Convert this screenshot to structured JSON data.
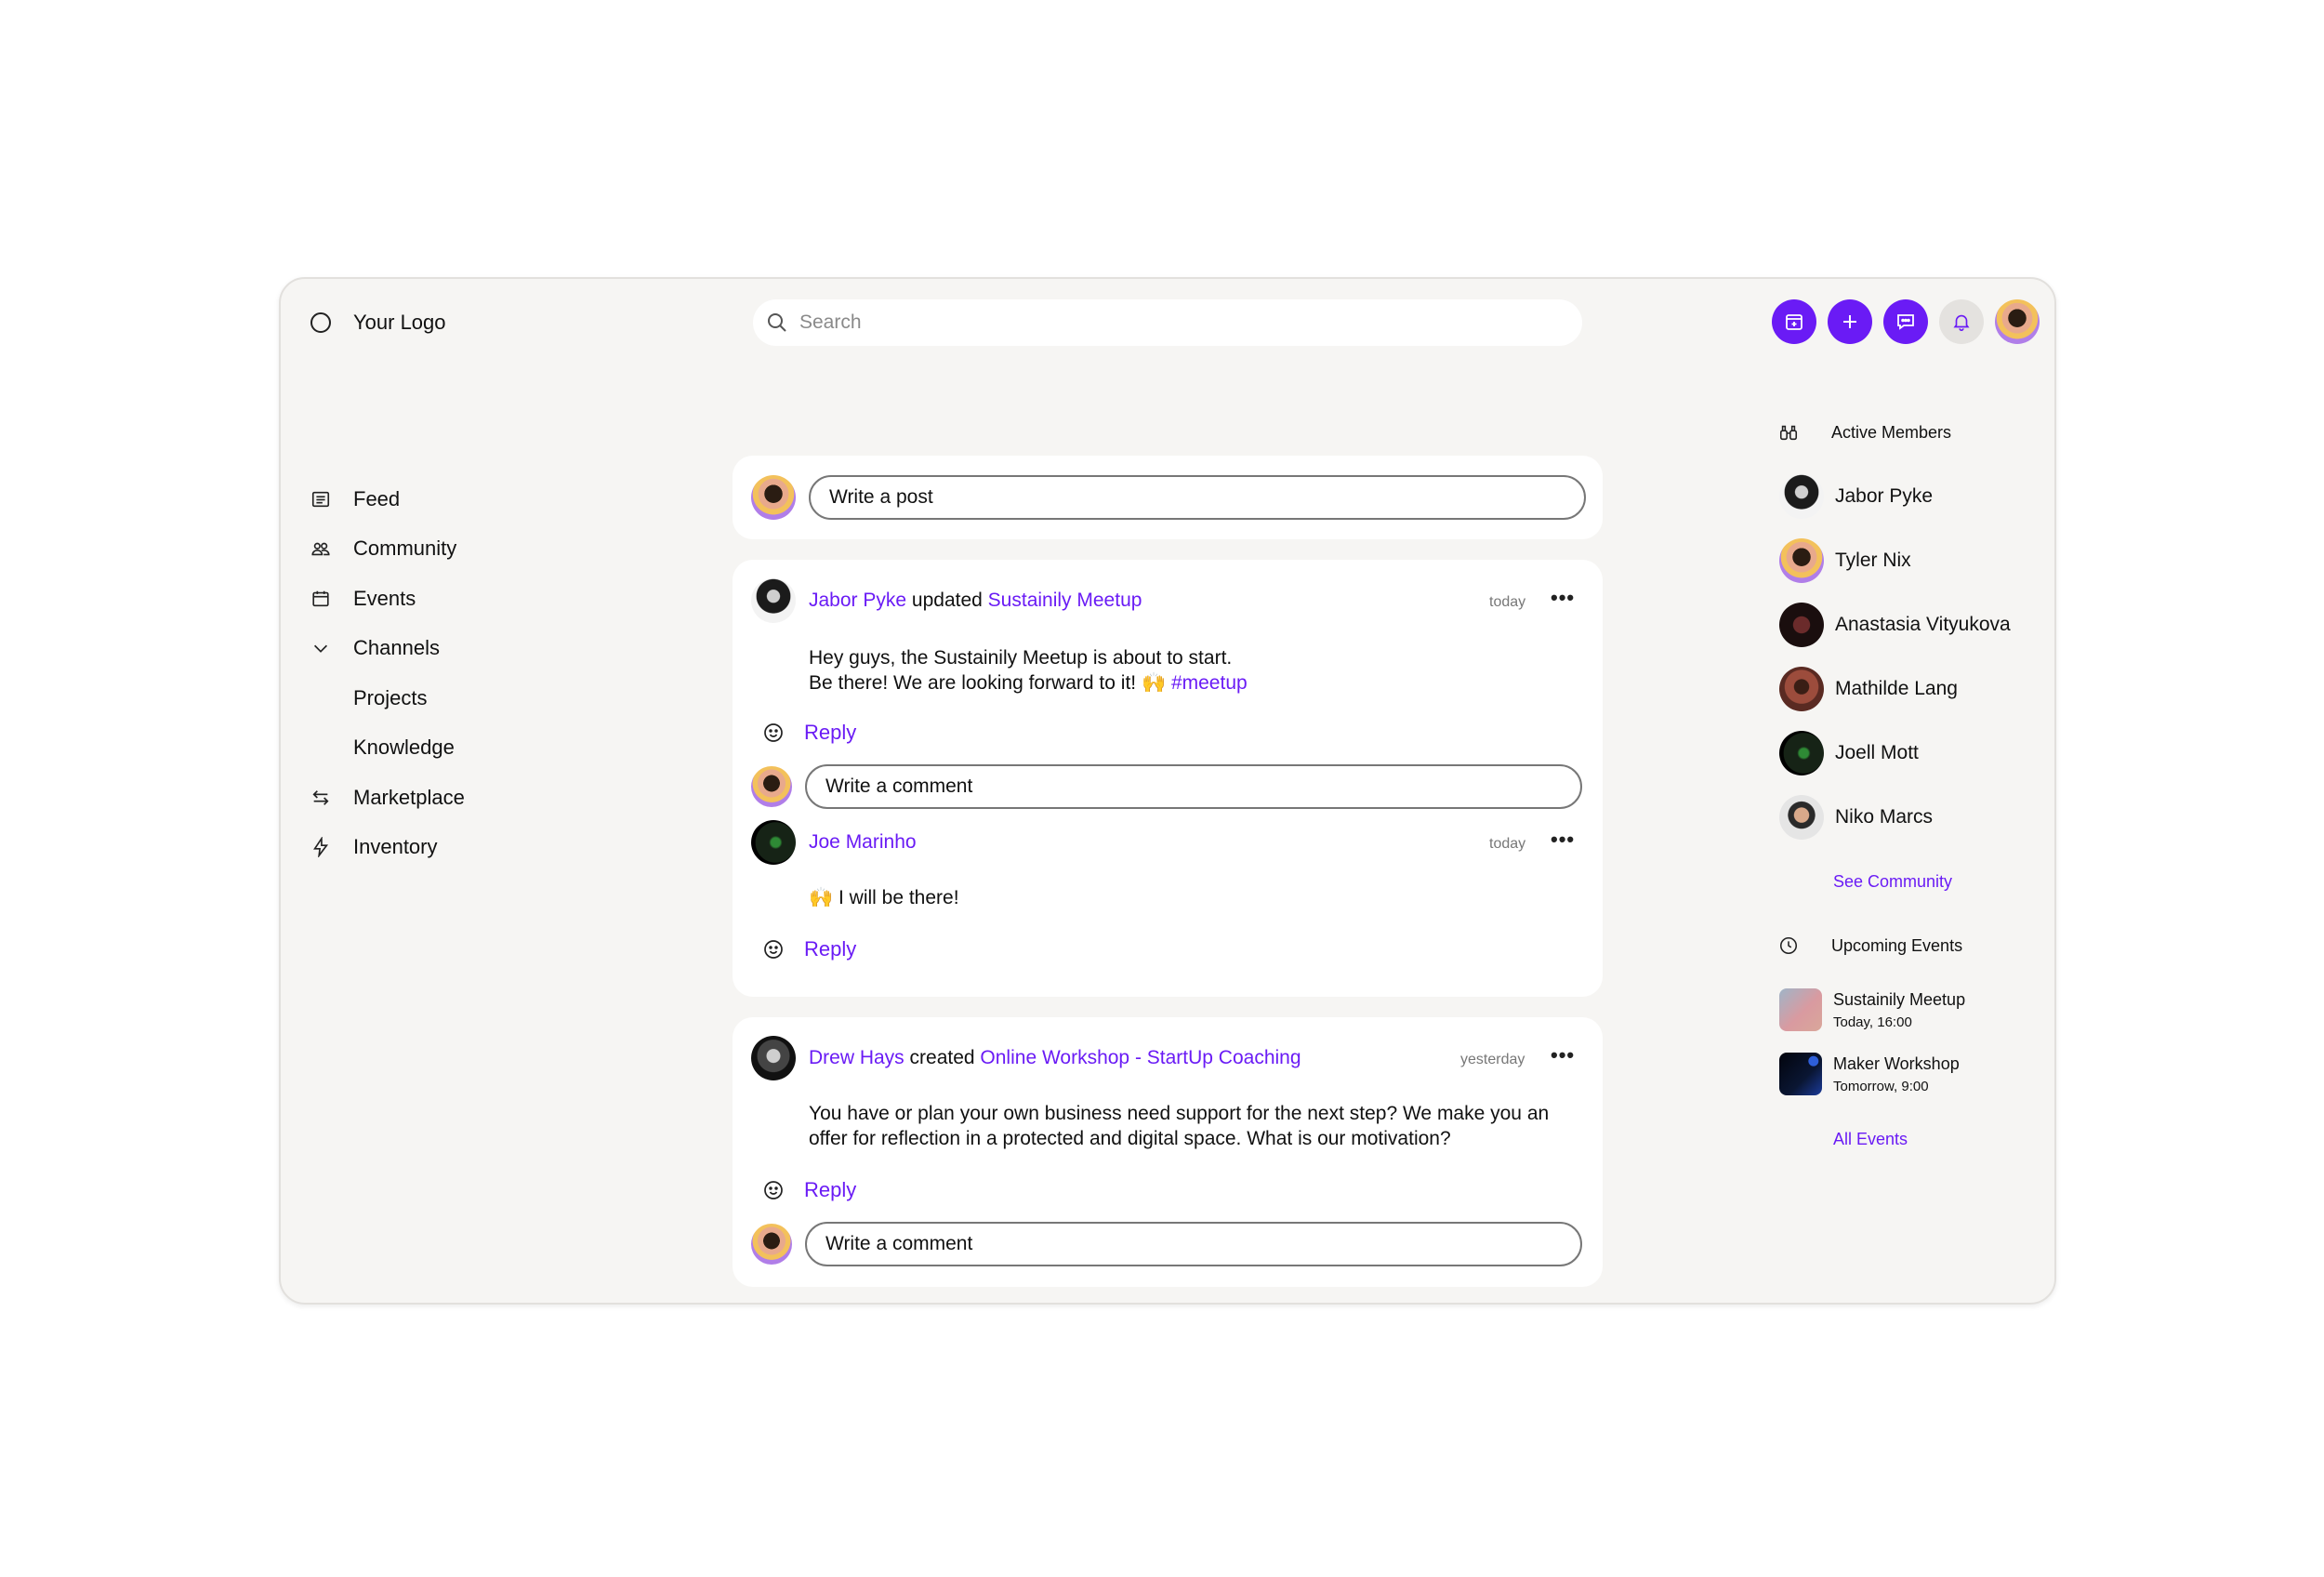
{
  "logo": {
    "text": "Your Logo"
  },
  "search": {
    "placeholder": "Search"
  },
  "header": {
    "actions": [
      "calendar-add-icon",
      "plus-icon",
      "chat-icon",
      "bell-icon"
    ],
    "accent_color": "#6a1bf5"
  },
  "nav": {
    "items": [
      {
        "label": "Feed",
        "icon": "feed-icon"
      },
      {
        "label": "Community",
        "icon": "community-icon"
      },
      {
        "label": "Events",
        "icon": "calendar-icon"
      },
      {
        "label": "Channels",
        "icon": "chevron-down-icon"
      },
      {
        "label": "Projects"
      },
      {
        "label": "Knowledge"
      },
      {
        "label": "Marketplace",
        "icon": "swap-icon"
      },
      {
        "label": "Inventory",
        "icon": "bolt-icon"
      }
    ]
  },
  "composer": {
    "placeholder": "Write a post"
  },
  "posts": [
    {
      "author": "Jabor Pyke",
      "action": "updated",
      "target": "Sustainily Meetup",
      "time": "today",
      "line1": "Hey guys, the Sustainily Meetup is about to start.",
      "line2": "Be there! We are looking forward to it! 🙌",
      "hashtag": "#meetup",
      "reply_label": "Reply",
      "comment_placeholder": "Write a comment",
      "comment": {
        "author": "Joe Marinho",
        "time": "today",
        "text": "🙌 I will be there!",
        "reply_label": "Reply"
      }
    },
    {
      "author": "Drew Hays",
      "action": "created",
      "target": "Online Workshop - StartUp Coaching",
      "time": "yesterday",
      "line1": "You have or plan your own business need support for the next step? We make you an",
      "line2": "offer for reflection in a protected and digital space. What is our motivation?",
      "reply_label": "Reply",
      "comment_placeholder": "Write a comment"
    }
  ],
  "right_panel": {
    "active_members_title": "Active Members",
    "members": [
      "Jabor Pyke",
      "Tyler Nix",
      "Anastasia Vityukova",
      "Mathilde Lang",
      "Joell Mott",
      "Niko Marcs"
    ],
    "see_community": "See Community",
    "upcoming_title": "Upcoming Events",
    "events": [
      {
        "name": "Sustainily Meetup",
        "time": "Today, 16:00"
      },
      {
        "name": "Maker Workshop",
        "time": "Tomorrow, 9:00"
      }
    ],
    "all_events": "All Events"
  }
}
